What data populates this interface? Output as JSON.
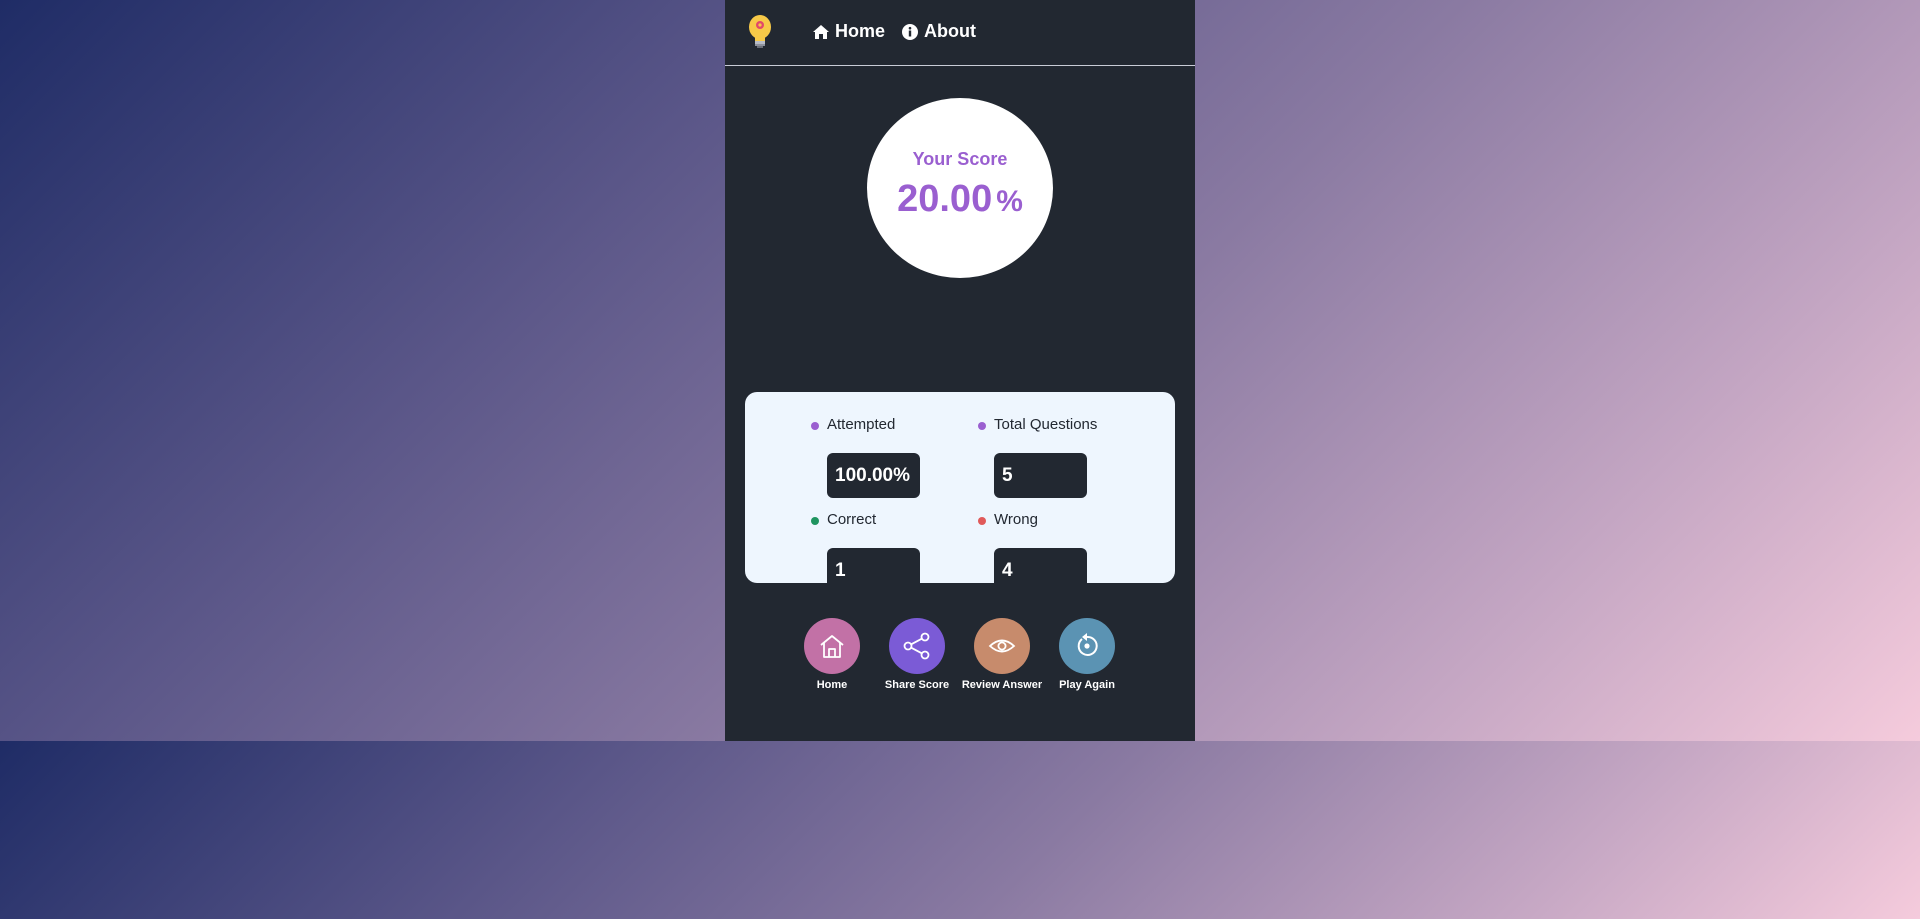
{
  "nav": {
    "logo_icon": "lightbulb-icon",
    "home_label": "Home",
    "about_label": "About"
  },
  "score": {
    "title": "Your Score",
    "value": "20.00",
    "unit": "%"
  },
  "stats": {
    "attempted": {
      "label": "Attempted",
      "value": "100.00%",
      "color": "#9a5fd0"
    },
    "total": {
      "label": "Total Questions",
      "value": "5",
      "color": "#9a5fd0"
    },
    "correct": {
      "label": "Correct",
      "value": "1",
      "color": "#1f9460"
    },
    "wrong": {
      "label": "Wrong",
      "value": "4",
      "color": "#e05a5a"
    }
  },
  "actions": {
    "home": {
      "label": "Home",
      "icon": "home-icon",
      "color": "#c271a6"
    },
    "share": {
      "label": "Share Score",
      "icon": "share-icon",
      "color": "#7b5bd6"
    },
    "review": {
      "label": "Review Answer",
      "icon": "eye-icon",
      "color": "#c78b6c"
    },
    "play": {
      "label": "Play Again",
      "icon": "replay-icon",
      "color": "#5b93b3"
    }
  },
  "colors": {
    "panel": "#222831",
    "accent": "#9a5fd0",
    "stats_bg": "#eef6fe"
  }
}
